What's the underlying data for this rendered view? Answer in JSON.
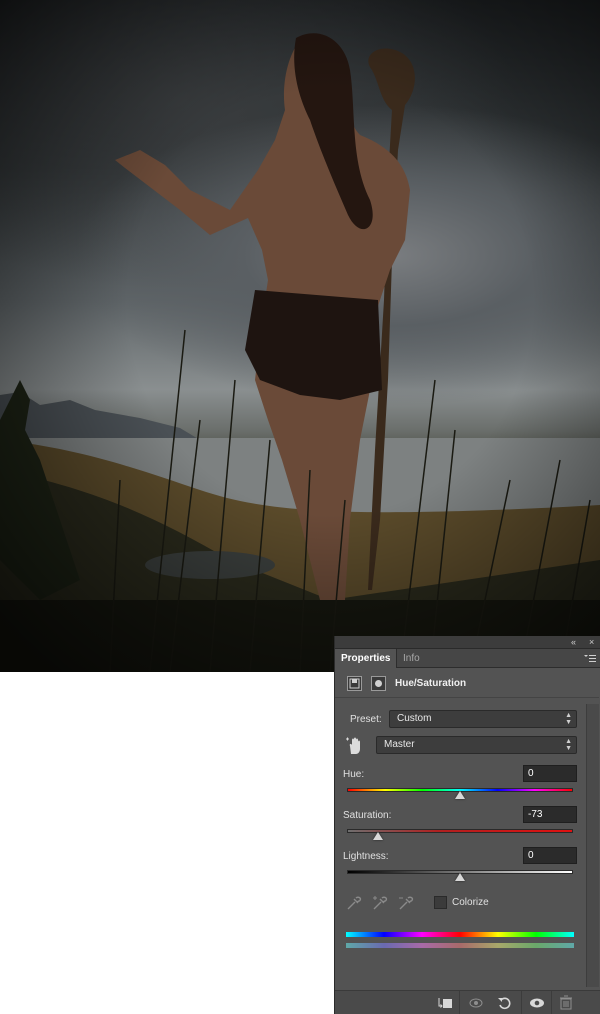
{
  "panel": {
    "collapse_glyph": "«",
    "close_glyph": "×",
    "tabs": [
      {
        "label": "Properties",
        "active": true
      },
      {
        "label": "Info",
        "active": false
      }
    ],
    "title": "Hue/Saturation",
    "preset_label": "Preset:",
    "preset_value": "Custom",
    "channel_value": "Master",
    "hue": {
      "label": "Hue:",
      "value": "0"
    },
    "saturation": {
      "label": "Saturation:",
      "value": "-73"
    },
    "lightness": {
      "label": "Lightness:",
      "value": "0"
    },
    "colorize_label": "Colorize",
    "colorize_checked": false,
    "icons": {
      "adjustment_layer": "adjustment-layer-icon",
      "mask": "layer-mask-icon",
      "target_adjust": "hand-target-icon",
      "eyedroppers": [
        "eyedropper-icon",
        "eyedropper-plus-icon",
        "eyedropper-minus-icon"
      ],
      "bottom": [
        "clip-to-layer-icon",
        "view-previous-icon",
        "reset-icon",
        "visibility-eye-icon",
        "trash-icon"
      ]
    },
    "colors": {
      "panel_bg": "#535353",
      "field_bg": "#2b2b2b",
      "saturation_track": "#c41d1d"
    }
  }
}
